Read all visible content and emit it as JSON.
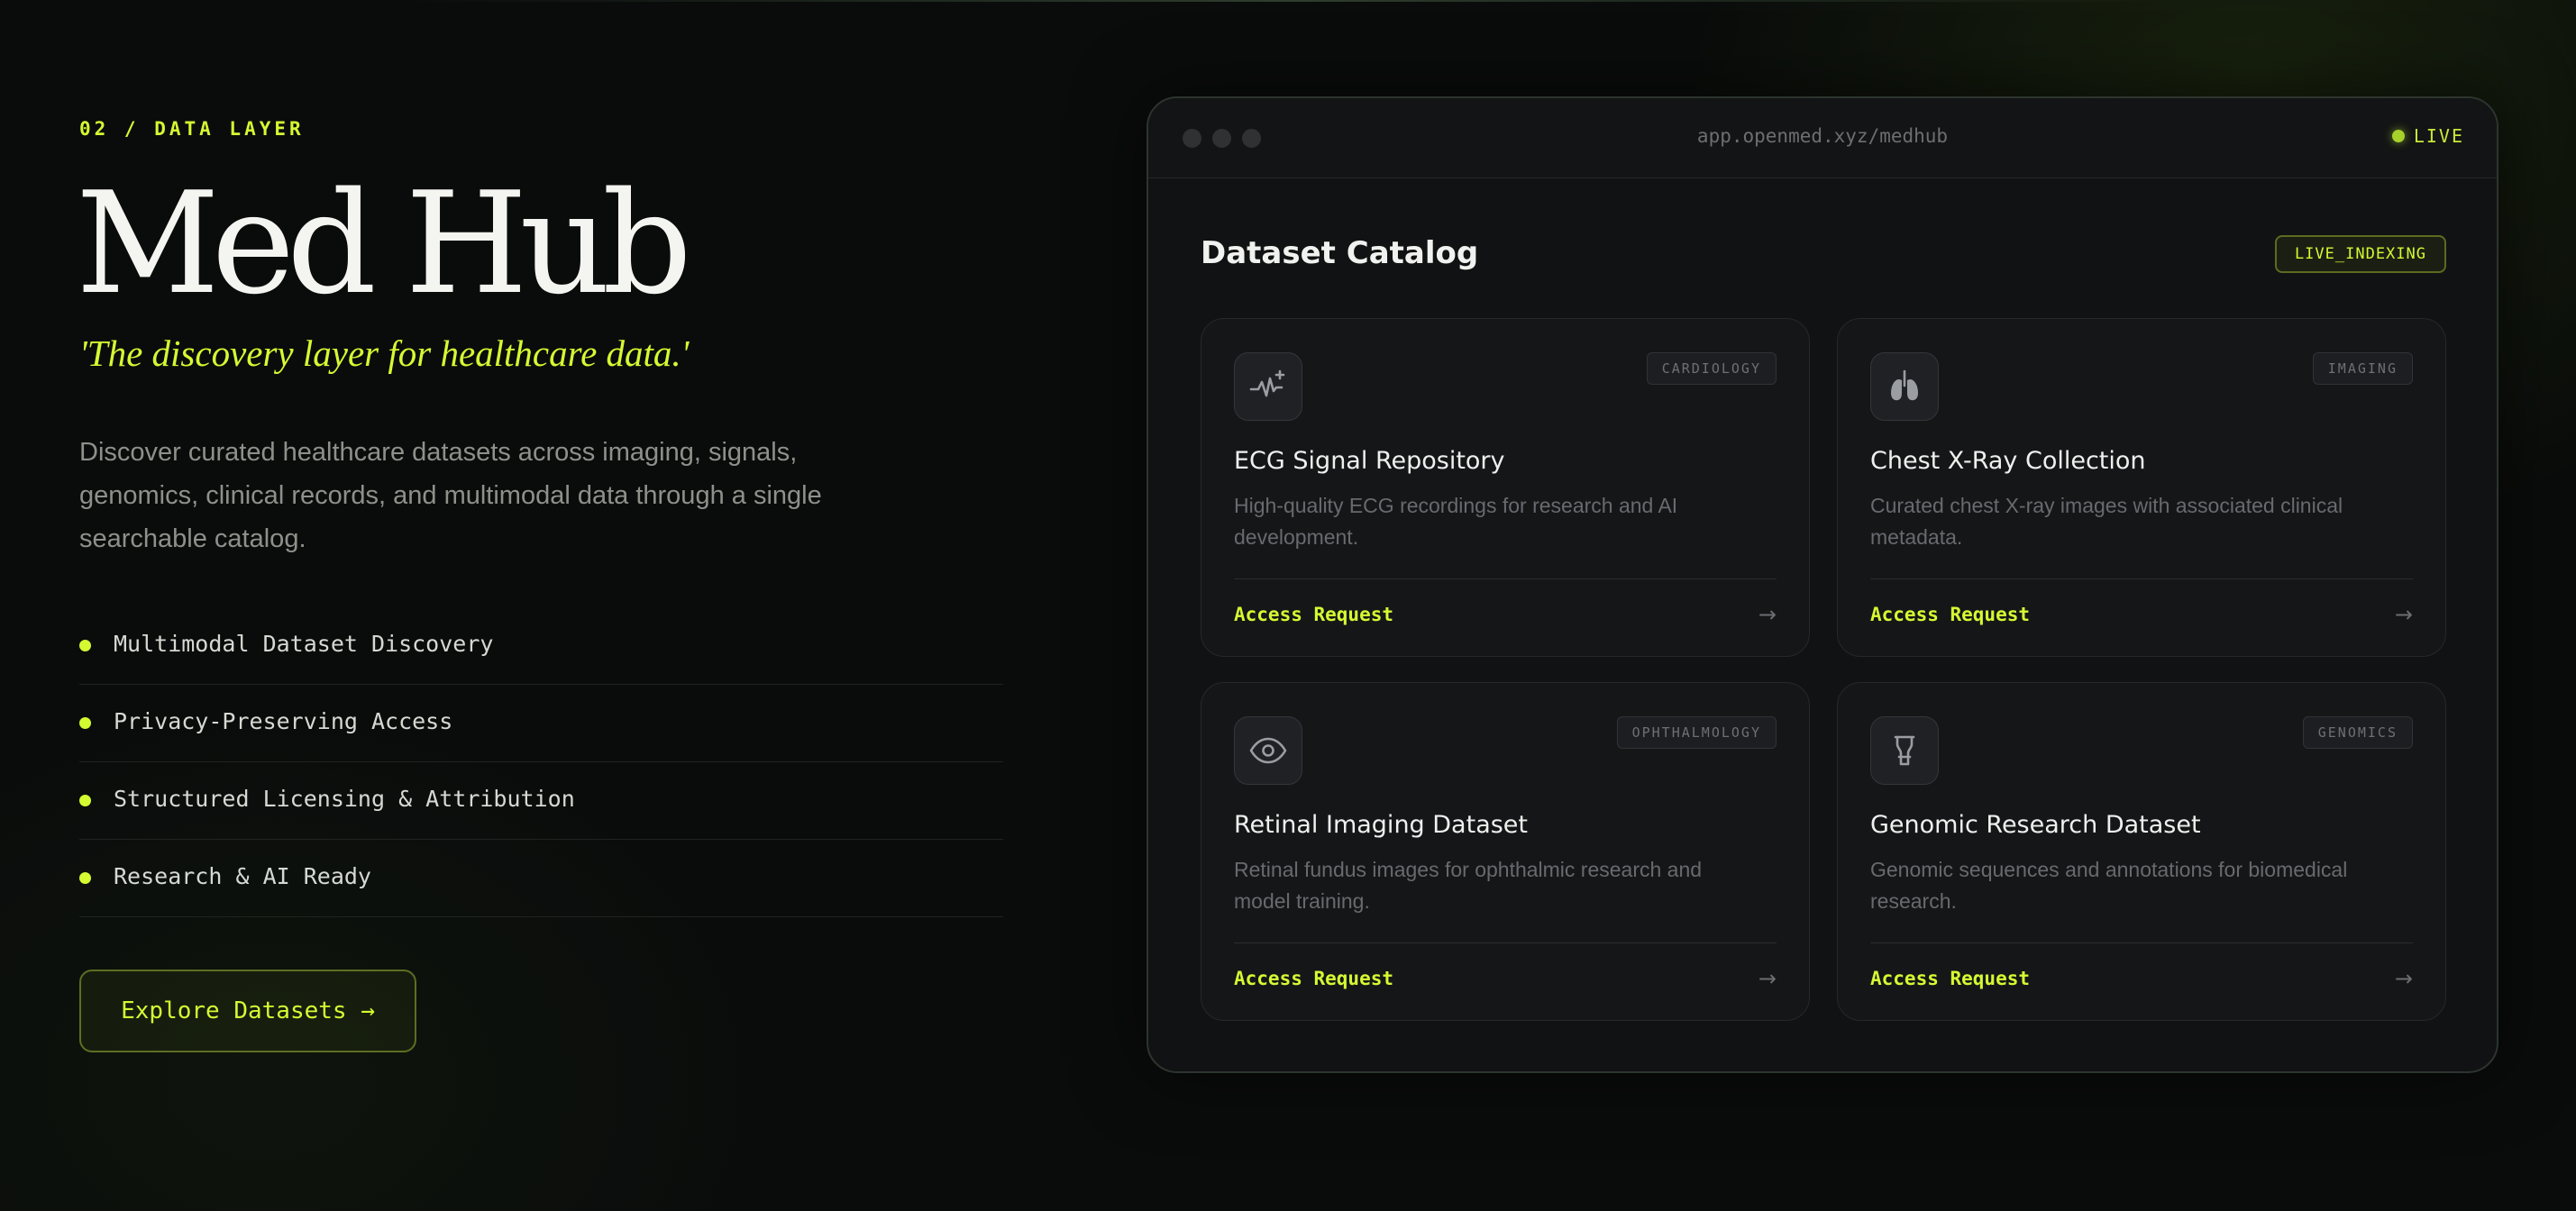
{
  "hero": {
    "eyebrow": "02 / DATA LAYER",
    "title": "Med Hub",
    "tagline": "'The discovery layer for healthcare data.'",
    "description": "Discover curated healthcare datasets across imaging, signals, genomics, clinical records, and multimodal data through a single searchable catalog.",
    "features": [
      {
        "label": "Multimodal Dataset Discovery"
      },
      {
        "label": "Privacy-Preserving Access"
      },
      {
        "label": "Structured Licensing & Attribution"
      },
      {
        "label": "Research & AI Ready"
      }
    ],
    "cta_label": "Explore Datasets →"
  },
  "window": {
    "url": "app.openmed.xyz/medhub",
    "live_label": "LIVE",
    "catalog_title": "Dataset Catalog",
    "indexing_badge": "LIVE_INDEXING",
    "cards": [
      {
        "icon": "ecg-pulse-icon",
        "tag": "CARDIOLOGY",
        "title": "ECG Signal Repository",
        "description": "High-quality ECG recordings for research and AI development.",
        "action": "Access Request"
      },
      {
        "icon": "lungs-icon",
        "tag": "IMAGING",
        "title": "Chest X-Ray Collection",
        "description": "Curated chest X-ray images with associated clinical metadata.",
        "action": "Access Request"
      },
      {
        "icon": "eye-icon",
        "tag": "OPHTHALMOLOGY",
        "title": "Retinal Imaging Dataset",
        "description": "Retinal fundus images for ophthalmic research and model training.",
        "action": "Access Request"
      },
      {
        "icon": "test-tube-icon",
        "tag": "GENOMICS",
        "title": "Genomic Research Dataset",
        "description": "Genomic sequences and annotations for biomedical research.",
        "action": "Access Request"
      }
    ]
  },
  "colors": {
    "accent": "#d4fa32",
    "background": "#0a0c0b",
    "card": "#151618"
  }
}
